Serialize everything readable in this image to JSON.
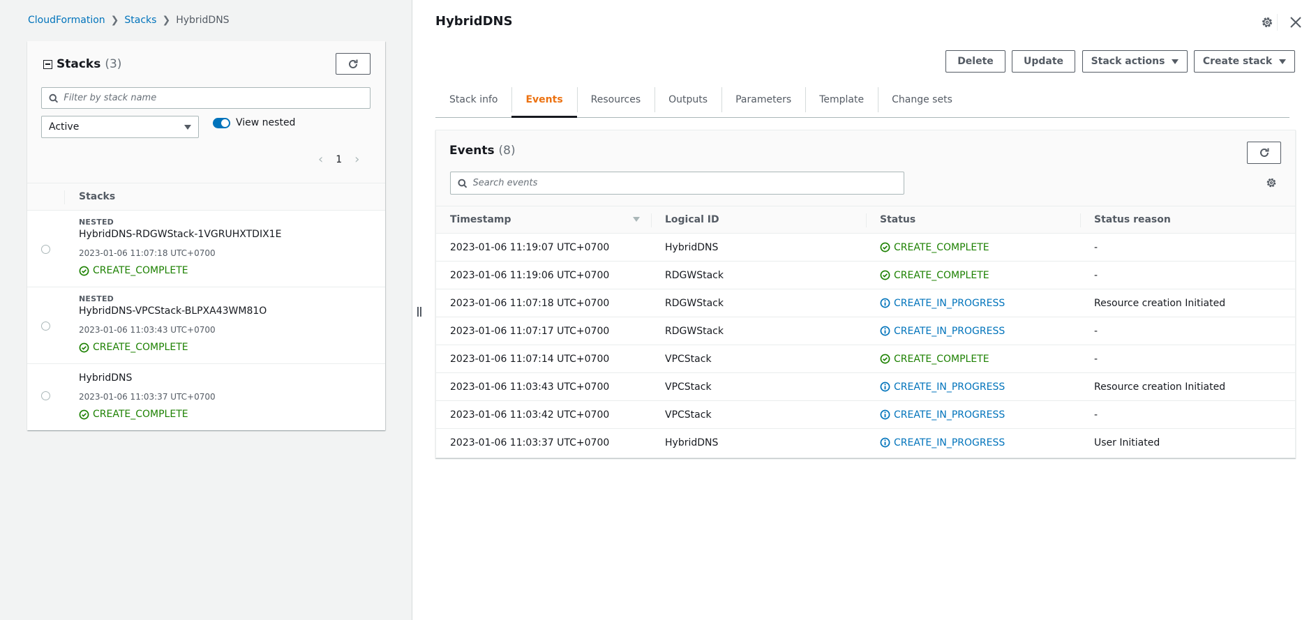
{
  "breadcrumb": [
    {
      "label": "CloudFormation",
      "link": true
    },
    {
      "label": "Stacks",
      "link": true
    },
    {
      "label": "HybridDNS",
      "link": false
    }
  ],
  "stacks_panel": {
    "title": "Stacks",
    "count": "(3)",
    "filter_placeholder": "Filter by stack name",
    "status_filter": "Active",
    "view_nested_label": "View nested",
    "view_nested_on": true,
    "page": "1",
    "column_header": "Stacks",
    "items": [
      {
        "nested_label": "NESTED",
        "name": "HybridDNS-RDGWStack-1VGRUHXTDIX1E",
        "created": "2023-01-06 11:07:18 UTC+0700",
        "status": "CREATE_COMPLETE"
      },
      {
        "nested_label": "NESTED",
        "name": "HybridDNS-VPCStack-BLPXA43WM81O",
        "created": "2023-01-06 11:03:43 UTC+0700",
        "status": "CREATE_COMPLETE"
      },
      {
        "nested_label": "",
        "name": "HybridDNS",
        "created": "2023-01-06 11:03:37 UTC+0700",
        "status": "CREATE_COMPLETE"
      }
    ]
  },
  "detail": {
    "title": "HybridDNS",
    "buttons": {
      "delete": "Delete",
      "update": "Update",
      "stack_actions": "Stack actions",
      "create_stack": "Create stack"
    },
    "tabs": [
      {
        "label": "Stack info",
        "active": false
      },
      {
        "label": "Events",
        "active": true
      },
      {
        "label": "Resources",
        "active": false
      },
      {
        "label": "Outputs",
        "active": false
      },
      {
        "label": "Parameters",
        "active": false
      },
      {
        "label": "Template",
        "active": false
      },
      {
        "label": "Change sets",
        "active": false
      }
    ]
  },
  "events": {
    "title": "Events",
    "count": "(8)",
    "search_placeholder": "Search events",
    "columns": [
      "Timestamp",
      "Logical ID",
      "Status",
      "Status reason"
    ],
    "rows": [
      {
        "timestamp": "2023-01-06 11:19:07 UTC+0700",
        "logical_id": "HybridDNS",
        "status": "CREATE_COMPLETE",
        "kind": "ok",
        "reason": "-"
      },
      {
        "timestamp": "2023-01-06 11:19:06 UTC+0700",
        "logical_id": "RDGWStack",
        "status": "CREATE_COMPLETE",
        "kind": "ok",
        "reason": "-"
      },
      {
        "timestamp": "2023-01-06 11:07:18 UTC+0700",
        "logical_id": "RDGWStack",
        "status": "CREATE_IN_PROGRESS",
        "kind": "info",
        "reason": "Resource creation Initiated"
      },
      {
        "timestamp": "2023-01-06 11:07:17 UTC+0700",
        "logical_id": "RDGWStack",
        "status": "CREATE_IN_PROGRESS",
        "kind": "info",
        "reason": "-"
      },
      {
        "timestamp": "2023-01-06 11:07:14 UTC+0700",
        "logical_id": "VPCStack",
        "status": "CREATE_COMPLETE",
        "kind": "ok",
        "reason": "-"
      },
      {
        "timestamp": "2023-01-06 11:03:43 UTC+0700",
        "logical_id": "VPCStack",
        "status": "CREATE_IN_PROGRESS",
        "kind": "info",
        "reason": "Resource creation Initiated"
      },
      {
        "timestamp": "2023-01-06 11:03:42 UTC+0700",
        "logical_id": "VPCStack",
        "status": "CREATE_IN_PROGRESS",
        "kind": "info",
        "reason": "-"
      },
      {
        "timestamp": "2023-01-06 11:03:37 UTC+0700",
        "logical_id": "HybridDNS",
        "status": "CREATE_IN_PROGRESS",
        "kind": "info",
        "reason": "User Initiated"
      }
    ]
  },
  "colors": {
    "link": "#0073bb",
    "success": "#1d8102",
    "info": "#0073bb",
    "active_tab": "#ec7211"
  }
}
